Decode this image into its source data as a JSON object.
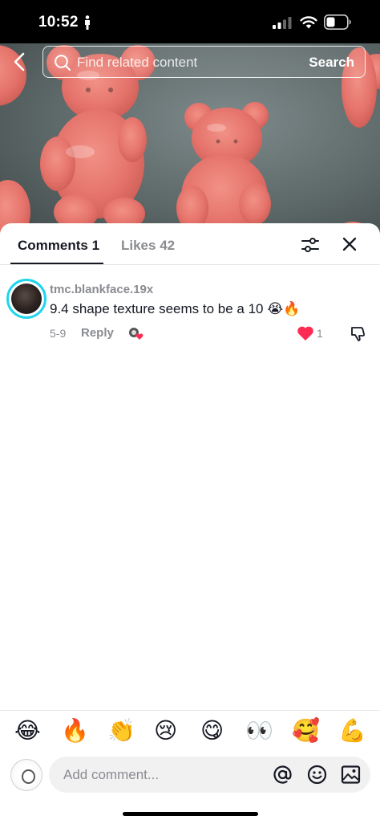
{
  "status_bar": {
    "time": "10:52"
  },
  "search": {
    "placeholder": "Find related content",
    "button_label": "Search"
  },
  "tabs": [
    {
      "label": "Comments 1"
    },
    {
      "label": "Likes 42"
    }
  ],
  "comment": {
    "username": "tmc.blankface.19x",
    "text": "9.4 shape texture seems to be a 10 😭🔥",
    "date": "5-9",
    "reply_label": "Reply",
    "like_count": "1"
  },
  "emoji_bar": [
    "😂",
    "🔥",
    "👏",
    "😢",
    "😋",
    "👀",
    "🥰",
    "💪"
  ],
  "composer": {
    "placeholder": "Add comment..."
  },
  "colors": {
    "accent_ring": "#20d5ec",
    "like_red": "#fe2c55",
    "muted": "#8a8b91"
  }
}
